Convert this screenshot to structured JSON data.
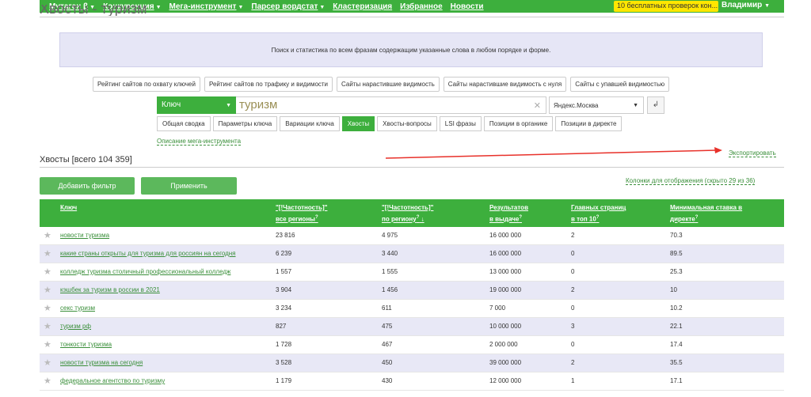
{
  "nav": {
    "items": [
      {
        "label": "Мутаген β",
        "caret": true
      },
      {
        "label": "Конкуренция",
        "caret": true
      },
      {
        "label": "Мега-инструмент",
        "caret": true
      },
      {
        "label": "Парсер вордстат",
        "caret": true
      },
      {
        "label": "Кластеризация",
        "caret": false
      },
      {
        "label": "Избранное",
        "caret": false
      },
      {
        "label": "Новости",
        "caret": false
      }
    ],
    "promo": "10 бесплатных проверок кон...",
    "user": "Владимир"
  },
  "page_title": "Хвосты - туризм",
  "info_text": "Поиск и статистика по всем фразам содержащим указанные слова в любом порядке и форме.",
  "tools": [
    "Рейтинг сайтов по охвату ключей",
    "Рейтинг сайтов по трафику и видимости",
    "Сайты нарастившие видимость",
    "Сайты нарастившие видимость с нуля",
    "Сайты с упавшей видимостью"
  ],
  "search": {
    "mode": "Ключ",
    "query": "туризм",
    "region": "Яндекс.Москва"
  },
  "tabs": [
    {
      "label": "Общая сводка",
      "active": false
    },
    {
      "label": "Параметры ключа",
      "active": false
    },
    {
      "label": "Вариации ключа",
      "active": false
    },
    {
      "label": "Хвосты",
      "active": true
    },
    {
      "label": "Хвосты-вопросы",
      "active": false
    },
    {
      "label": "LSI фразы",
      "active": false
    },
    {
      "label": "Позиции в органике",
      "active": false
    },
    {
      "label": "Позиции в директе",
      "active": false
    }
  ],
  "description_link": "Описание мега-инструмента",
  "section_title": "Хвосты [всего 104 359]",
  "export_label": "Экспортировать",
  "add_filter_label": "Добавить фильтр",
  "apply_label": "Применить",
  "columns_link": "Колонки для отображения (скрыто 29 из 36)",
  "columns": {
    "keyword": "Ключ",
    "freq_all_1": "\"[!Частотность]\"",
    "freq_all_2": "все регионы",
    "freq_reg_1": "\"[!Частотность]\"",
    "freq_reg_2": "по региону",
    "results_1": "Результатов",
    "results_2": "в выдаче",
    "main_1": "Главных страниц",
    "main_2": "в топ 10",
    "bid_1": "Минимальная ставка в",
    "bid_2": "директе"
  },
  "rows": [
    {
      "keyword": "новости туризма",
      "freq_all": "23 816",
      "freq_reg": "4 975",
      "results": "16 000 000",
      "main_pages": "2",
      "bid": "70.3"
    },
    {
      "keyword": "какие страны открыты для туризма для россиян на сегодня",
      "freq_all": "6 239",
      "freq_reg": "3 440",
      "results": "16 000 000",
      "main_pages": "0",
      "bid": "89.5"
    },
    {
      "keyword": "колледж туризма столичный профессиональный колледж",
      "freq_all": "1 557",
      "freq_reg": "1 555",
      "results": "13 000 000",
      "main_pages": "0",
      "bid": "25.3"
    },
    {
      "keyword": "кэшбек за туризм в россии в 2021",
      "freq_all": "3 904",
      "freq_reg": "1 456",
      "results": "19 000 000",
      "main_pages": "2",
      "bid": "10"
    },
    {
      "keyword": "секс туризм",
      "freq_all": "3 234",
      "freq_reg": "611",
      "results": "7 000",
      "main_pages": "0",
      "bid": "10.2"
    },
    {
      "keyword": "туризм рф",
      "freq_all": "827",
      "freq_reg": "475",
      "results": "10 000 000",
      "main_pages": "3",
      "bid": "22.1"
    },
    {
      "keyword": "тонкости туризма",
      "freq_all": "1 728",
      "freq_reg": "467",
      "results": "2 000 000",
      "main_pages": "0",
      "bid": "17.4"
    },
    {
      "keyword": "новости туризма на сегодня",
      "freq_all": "3 528",
      "freq_reg": "450",
      "results": "39 000 000",
      "main_pages": "2",
      "bid": "35.5"
    },
    {
      "keyword": "федеральное агентство по туризму",
      "freq_all": "1 179",
      "freq_reg": "430",
      "results": "12 000 000",
      "main_pages": "1",
      "bid": "17.1"
    }
  ],
  "colors": {
    "accent": "#3daf3d",
    "alt_row": "#e8e8f6",
    "arrow": "#e8312a"
  }
}
